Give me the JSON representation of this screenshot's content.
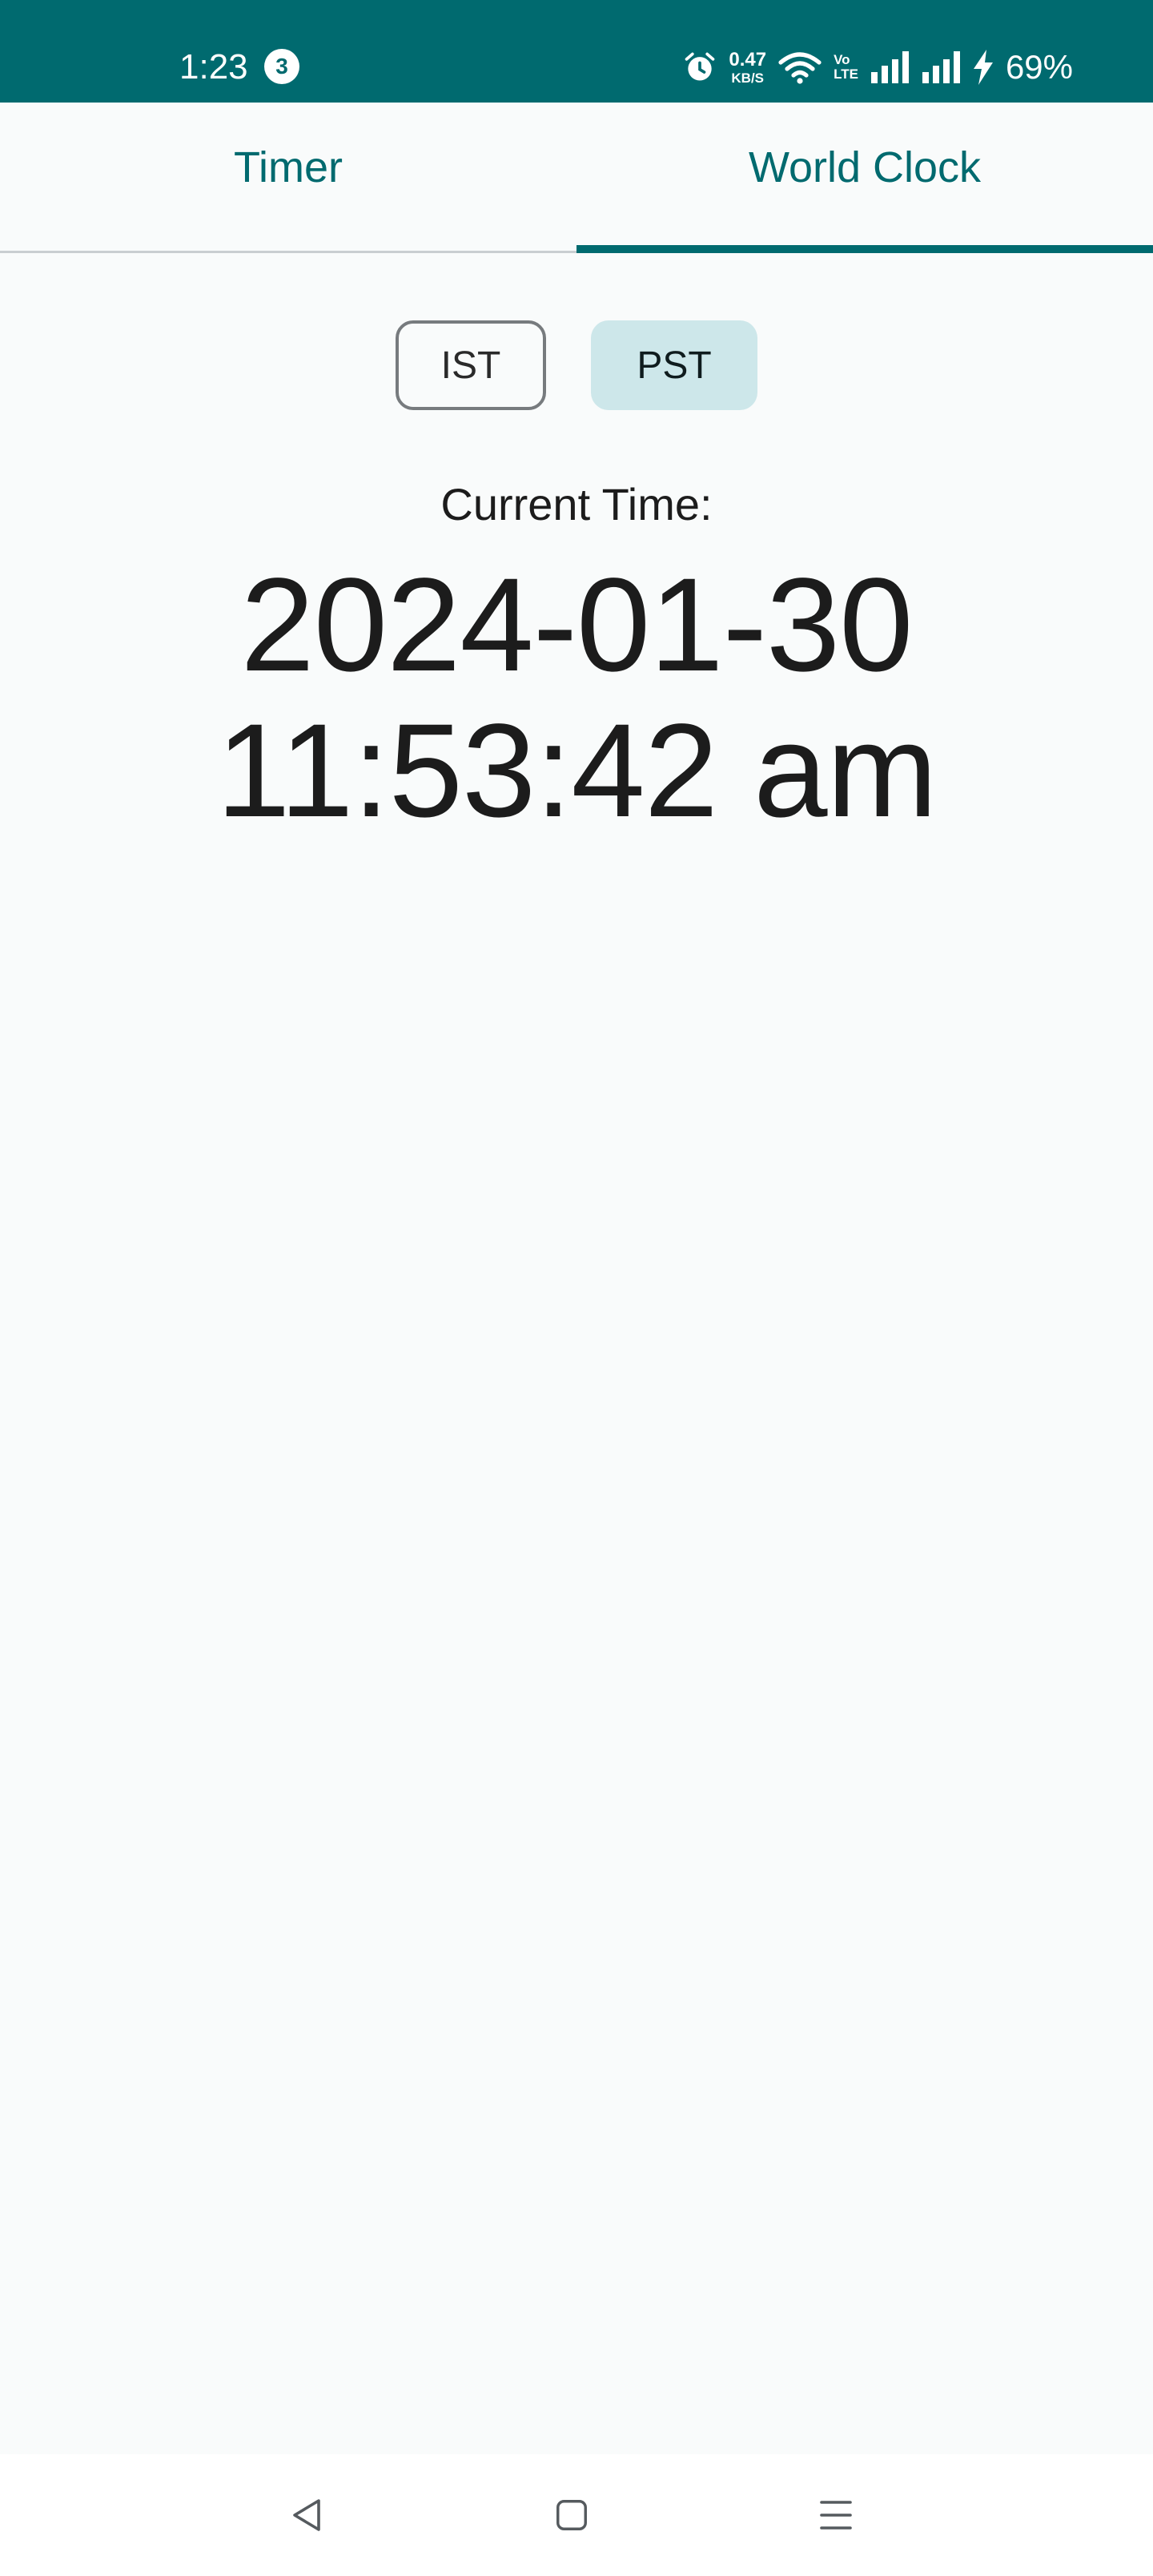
{
  "status_bar": {
    "time": "1:23",
    "notification_count": "3",
    "net_speed_value": "0.47",
    "net_speed_unit": "KB/S",
    "volte_top": "Vo",
    "volte_bottom": "LTE",
    "battery": "69%",
    "icons": [
      "alarm-icon",
      "wifi-icon",
      "volte-icon",
      "signal-icon",
      "signal-icon",
      "charging-icon"
    ]
  },
  "tabs": [
    {
      "label": "Timer",
      "selected": false
    },
    {
      "label": "World Clock",
      "selected": true
    }
  ],
  "timezones": {
    "ist": "IST",
    "pst": "PST",
    "selected": "PST"
  },
  "clock": {
    "label": "Current Time:",
    "date": "2024-01-30",
    "time": "11:53:42 am"
  },
  "nav": {
    "icons": [
      "back-icon",
      "home-icon",
      "menu-icon"
    ]
  },
  "colors": {
    "accent": "#006a6f",
    "selected_chip": "#cde7ea",
    "background": "#f9fbfb"
  }
}
